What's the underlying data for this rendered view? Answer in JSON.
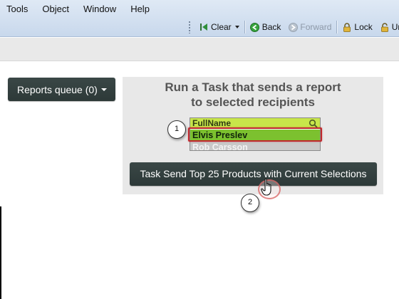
{
  "menu": {
    "items": [
      {
        "label": "Tools"
      },
      {
        "label": "Object"
      },
      {
        "label": "Window"
      },
      {
        "label": "Help"
      }
    ]
  },
  "toolbar": {
    "clear_label": "Clear",
    "back_label": "Back",
    "forward_label": "Forward",
    "lock_label": "Lock",
    "unlock_label": "Unlo"
  },
  "reports_queue": {
    "label": "Reports queue (0)"
  },
  "task_panel": {
    "heading_line1": "Run a Task that sends a report",
    "heading_line2": "to selected recipients",
    "listbox": {
      "header": "FullName",
      "rows": [
        "Elvis Preslev",
        "Rob Carsson"
      ],
      "selected_index": 0
    },
    "task_button_label": "Task Send Top 25 Products with Current Selections"
  },
  "steps": [
    "1",
    "2"
  ],
  "colors": {
    "dark_button": "#33403f",
    "listbox_header": "#c8e64a",
    "selected_row": "#7cc12f",
    "highlight": "#c0282d"
  }
}
